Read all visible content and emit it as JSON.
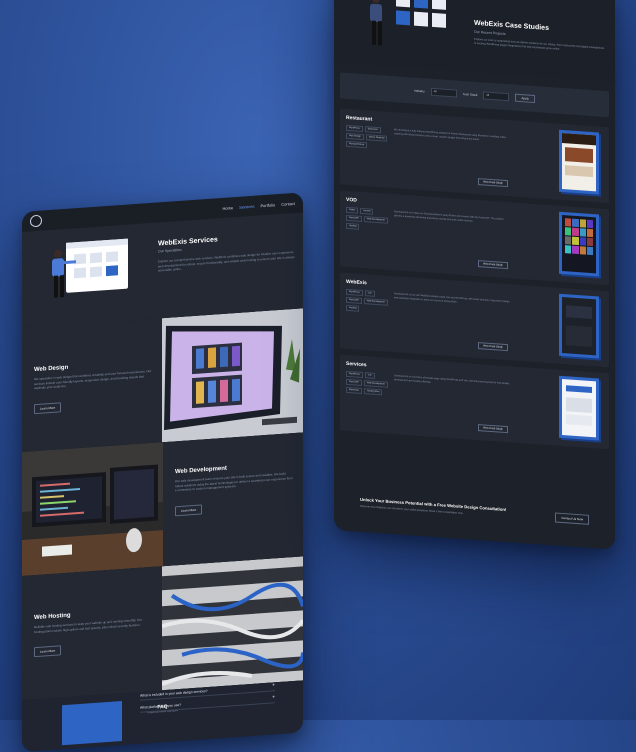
{
  "left": {
    "nav": [
      "Home",
      "Services",
      "Portfolio",
      "Contact"
    ],
    "hero": {
      "title": "WebExis Services",
      "subtitle": "Our Specialties",
      "description": "Explore our comprehensive web services. WebExis combines web design for intuitive user experience, web development for robust, secure functionality, and reliable web hosting to ensure your site is always accessible online."
    },
    "services": [
      {
        "title": "Web Design",
        "description": "We specialize in web design that combines creativity and user focused experiences. Our services include user-friendly layouts, responsive design, and branding visuals that captivate your audience.",
        "button": "Learn More"
      },
      {
        "title": "Web Development",
        "description": "Our web development team ensures your site is built secure and scalable. We build robust solutions using the latest technologies to deliver a seamless user experience from e-commerce to custom management systems.",
        "button": "Learn More"
      },
      {
        "title": "Web Hosting",
        "description": "Reliable web hosting services to keep your website up and running smoothly. Our hosting plans include high uptime and fast speeds, plus robust security features.",
        "button": "Learn More"
      }
    ],
    "faq": {
      "title": "FAQ",
      "subtitle": "Frequently Asked Questions",
      "questions": [
        "What is included in your web design services?",
        "What platforms do you use?"
      ]
    }
  },
  "right": {
    "hero": {
      "title": "WebExis Case Studies",
      "subtitle": "Our Recent Projects",
      "description": "Explore our work to understand how we deliver solutions for our clients, from restaurants and digital marketplaces to exciting WordPress plugin integrations that help businesses grow online."
    },
    "filter": {
      "industry_label": "Industry",
      "industry_value": "All",
      "tech_label": "Tech Stack",
      "tech_value": "All",
      "apply": "Apply"
    },
    "cases": [
      {
        "name": "Restaurant",
        "tags": [
          "WordPress",
          "Elementor",
          "Web Design",
          "Online Ordering",
          "WooCommerce"
        ],
        "description": "We developed a fully featured WordPress website for Kanton Restaurant using Elementor, enabling online ordering with WooCommerce and a clean, modern design that reflects the brand.",
        "button": "View Case Study"
      },
      {
        "name": "VOD",
        "tags": [
          "Flutter",
          "Laravel",
          "Portal API",
          "Web Development",
          "Hosting"
        ],
        "description": "Development of a Video-on-Demand platform using Flutter and Laravel with the Portal API. The solution delivers a seamless streaming experience across web and mobile devices.",
        "button": "View Case Study"
      },
      {
        "name": "WebExis",
        "tags": [
          "WordPress",
          "Vue",
          "Portal API",
          "Web Development",
          "Hosting"
        ],
        "description": "Development of our own WebExis website using Vue and WordPress, with clean structure, responsive design and seamless integration to show our services and portfolio.",
        "button": "View Case Study"
      },
      {
        "name": "Services",
        "tags": [
          "WordPress",
          "Vue",
          "Portal API",
          "Web Development",
          "Elementor",
          "Hosting Plan"
        ],
        "description": "Development of a services showcase page using WordPress and Vue, with structured layouts for web design, development and hosting offerings.",
        "button": "View Case Study"
      }
    ],
    "cta": {
      "title": "Unlock Your Business Potential with a Free Website Design Consultation!",
      "description": "Discover how WebExis can transform your online presence. Book a free consultation now.",
      "button": "Contact Us Now"
    }
  }
}
